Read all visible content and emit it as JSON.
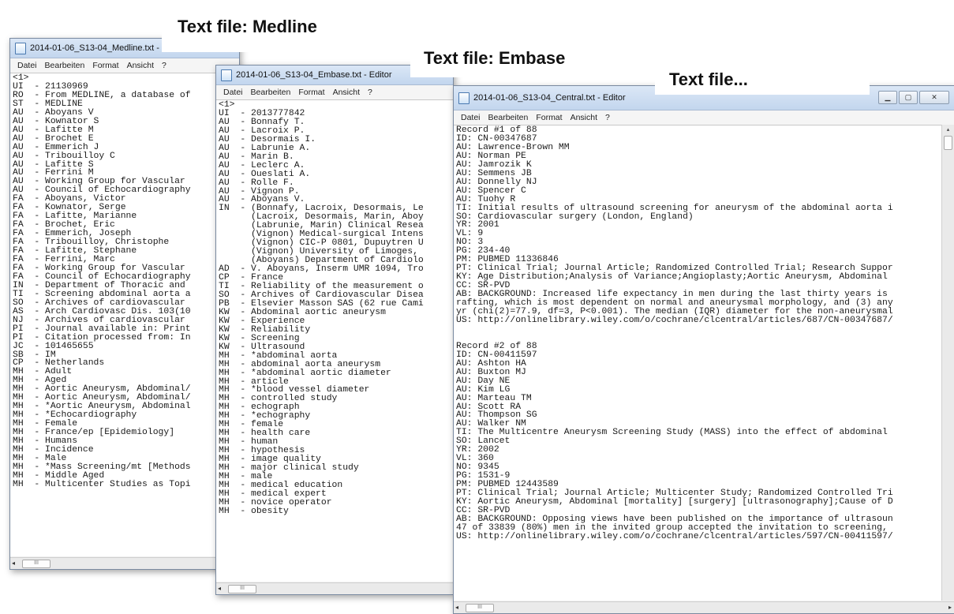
{
  "menu": [
    "Datei",
    "Bearbeiten",
    "Format",
    "Ansicht",
    "?"
  ],
  "labels": {
    "medline": "Text file: Medline",
    "embase": "Text file: Embase",
    "central": "Text file..."
  },
  "medline": {
    "title": "2014-01-06_S13-04_Medline.txt -",
    "lines": [
      "<1>",
      "UI  - 21130969",
      "RO  - From MEDLINE, a database of",
      "ST  - MEDLINE",
      "AU  - Aboyans V",
      "AU  - Kownator S",
      "AU  - Lafitte M",
      "AU  - Brochet E",
      "AU  - Emmerich J",
      "AU  - Tribouilloy C",
      "AU  - Lafitte S",
      "AU  - Ferrini M",
      "AU  - Working Group for Vascular",
      "AU  - Council of Echocardiography",
      "FA  - Aboyans, Victor",
      "FA  - Kownator, Serge",
      "FA  - Lafitte, Marianne",
      "FA  - Brochet, Eric",
      "FA  - Emmerich, Joseph",
      "FA  - Tribouilloy, Christophe",
      "FA  - Lafitte, Stephane",
      "FA  - Ferrini, Marc",
      "FA  - Working Group for Vascular",
      "FA  - Council of Echocardiography",
      "IN  - Department of Thoracic and",
      "TI  - Screening abdominal aorta a",
      "SO  - Archives of cardiovascular",
      "AS  - Arch Cardiovasc Dis. 103(10",
      "NJ  - Archives of cardiovascular",
      "PI  - Journal available in: Print",
      "PI  - Citation processed from: In",
      "JC  - 101465655",
      "SB  - IM",
      "CP  - Netherlands",
      "MH  - Adult",
      "MH  - Aged",
      "MH  - Aortic Aneurysm, Abdominal/",
      "MH  - Aortic Aneurysm, Abdominal/",
      "MH  - *Aortic Aneurysm, Abdominal",
      "MH  - *Echocardiography",
      "MH  - Female",
      "MH  - France/ep [Epidemiology]",
      "MH  - Humans",
      "MH  - Incidence",
      "MH  - Male",
      "MH  - *Mass Screening/mt [Methods",
      "MH  - Middle Aged",
      "MH  - Multicenter Studies as Topi"
    ]
  },
  "embase": {
    "title": "2014-01-06_S13-04_Embase.txt - Editor",
    "lines": [
      "<1>",
      "UI  - 2013777842",
      "AU  - Bonnafy T.",
      "AU  - Lacroix P.",
      "AU  - Desormais I.",
      "AU  - Labrunie A.",
      "AU  - Marin B.",
      "AU  - Leclerc A.",
      "AU  - Oueslati A.",
      "AU  - Rolle F.",
      "AU  - Vignon P.",
      "AU  - Aboyans V.",
      "IN  - (Bonnafy, Lacroix, Desormais, Le",
      "      (Lacroix, Desormais, Marin, Aboy",
      "      (Labrunie, Marin) Clinical Resea",
      "      (Vignon) Medical-surgical Intens",
      "      (Vignon) CIC-P 0801, Dupuytren U",
      "      (Vignon) University of Limoges,",
      "      (Aboyans) Department of Cardiolo",
      "AD  - V. Aboyans, Inserm UMR 1094, Tro",
      "CP  - France",
      "TI  - Reliability of the measurement o",
      "SO  - Archives of Cardiovascular Disea",
      "PB  - Elsevier Masson SAS (62 rue Cami",
      "KW  - Abdominal aortic aneurysm",
      "KW  - Experience",
      "KW  - Reliability",
      "KW  - Screening",
      "KW  - Ultrasound",
      "MH  - *abdominal aorta",
      "MH  - abdominal aorta aneurysm",
      "MH  - *abdominal aortic diameter",
      "MH  - article",
      "MH  - *blood vessel diameter",
      "MH  - controlled study",
      "MH  - echograph",
      "MH  - *echography",
      "MH  - female",
      "MH  - health care",
      "MH  - human",
      "MH  - hypothesis",
      "MH  - image quality",
      "MH  - major clinical study",
      "MH  - male",
      "MH  - medical education",
      "MH  - medical expert",
      "MH  - novice operator",
      "MH  - obesity"
    ]
  },
  "central": {
    "title": "2014-01-06_S13-04_Central.txt - Editor",
    "lines": [
      "Record #1 of 88",
      "ID: CN-00347687",
      "AU: Lawrence-Brown MM",
      "AU: Norman PE",
      "AU: Jamrozik K",
      "AU: Semmens JB",
      "AU: Donnelly NJ",
      "AU: Spencer C",
      "AU: Tuohy R",
      "TI: Initial results of ultrasound screening for aneurysm of the abdominal aorta i",
      "SO: Cardiovascular surgery (London, England)",
      "YR: 2001",
      "VL: 9",
      "NO: 3",
      "PG: 234-40",
      "PM: PUBMED 11336846",
      "PT: Clinical Trial; Journal Article; Randomized Controlled Trial; Research Suppor",
      "KY: Age Distribution;Analysis of Variance;Angioplasty;Aortic Aneurysm, Abdominal",
      "CC: SR-PVD",
      "AB: BACKGROUND: Increased life expectancy in men during the last thirty years is",
      "rafting, which is most dependent on normal and aneurysmal morphology, and (3) any",
      "yr (chi(2)=77.9, df=3, P<0.001). The median (IQR) diameter for the non-aneurysmal",
      "US: http://onlinelibrary.wiley.com/o/cochrane/clcentral/articles/687/CN-00347687/",
      "",
      "",
      "Record #2 of 88",
      "ID: CN-00411597",
      "AU: Ashton HA",
      "AU: Buxton MJ",
      "AU: Day NE",
      "AU: Kim LG",
      "AU: Marteau TM",
      "AU: Scott RA",
      "AU: Thompson SG",
      "AU: Walker NM",
      "TI: The Multicentre Aneurysm Screening Study (MASS) into the effect of abdominal",
      "SO: Lancet",
      "YR: 2002",
      "VL: 360",
      "NO: 9345",
      "PG: 1531-9",
      "PM: PUBMED 12443589",
      "PT: Clinical Trial; Journal Article; Multicenter Study; Randomized Controlled Tri",
      "KY: Aortic Aneurysm, Abdominal [mortality] [surgery] [ultrasonography];Cause of D",
      "CC: SR-PVD",
      "AB: BACKGROUND: Opposing views have been published on the importance of ultrasoun",
      "47 of 33839 (80%) men in the invited group accepted the invitation to screening,",
      "US: http://onlinelibrary.wiley.com/o/cochrane/clcentral/articles/597/CN-00411597/"
    ]
  }
}
